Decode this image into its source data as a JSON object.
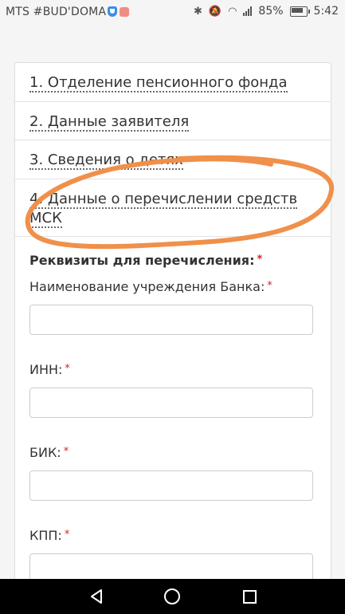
{
  "status_bar": {
    "carrier": "MTS #BUD'DOMA",
    "battery_percent": "85%",
    "time": "5:42",
    "icons": [
      "shield-icon",
      "app-icon",
      "bluetooth-icon",
      "mute-icon",
      "wifi-icon",
      "signal-icon",
      "battery-icon"
    ]
  },
  "steps": [
    {
      "label": "1. Отделение пенсионного фонда"
    },
    {
      "label": "2. Данные заявителя"
    },
    {
      "label": "3. Сведения о детях"
    },
    {
      "label": "4. Данные о перечислении средств МСК"
    }
  ],
  "form": {
    "section_title": "Реквизиты для перечисления:",
    "required_mark": "*",
    "fields": [
      {
        "label": "Наименование учреждения Банка:",
        "value": ""
      },
      {
        "label": "ИНН:",
        "value": ""
      },
      {
        "label": "БИК:",
        "value": ""
      },
      {
        "label": "КПП:",
        "value": ""
      }
    ]
  },
  "annotation": {
    "color": "#f0904a",
    "shape": "hand-drawn-ellipse"
  },
  "nav_bar": {
    "icons": [
      "back-icon",
      "home-icon",
      "recent-apps-icon"
    ]
  }
}
